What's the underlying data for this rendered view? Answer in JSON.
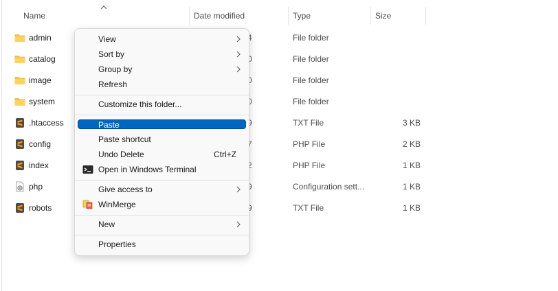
{
  "columns": {
    "name": "Name",
    "date": "Date modified",
    "type": "Type",
    "size": "Size"
  },
  "files": [
    {
      "name": "admin",
      "date": "4",
      "type": "File folder",
      "size": "",
      "icon": "folder-icon"
    },
    {
      "name": "catalog",
      "date": "0",
      "type": "File folder",
      "size": "",
      "icon": "folder-icon"
    },
    {
      "name": "image",
      "date": "0",
      "type": "File folder",
      "size": "",
      "icon": "folder-icon"
    },
    {
      "name": "system",
      "date": "0",
      "type": "File folder",
      "size": "",
      "icon": "folder-icon"
    },
    {
      "name": ".htaccess",
      "date": "9",
      "type": "TXT File",
      "size": "3 KB",
      "icon": "sublime-file-icon"
    },
    {
      "name": "config",
      "date": "7",
      "type": "PHP File",
      "size": "2 KB",
      "icon": "sublime-file-icon"
    },
    {
      "name": "index",
      "date": "2",
      "type": "PHP File",
      "size": "1 KB",
      "icon": "sublime-file-icon"
    },
    {
      "name": "php",
      "date": "9",
      "type": "Configuration sett...",
      "size": "1 KB",
      "icon": "config-file-icon"
    },
    {
      "name": "robots",
      "date": "9",
      "type": "TXT File",
      "size": "1 KB",
      "icon": "sublime-file-icon"
    }
  ],
  "menu": {
    "view": "View",
    "sort_by": "Sort by",
    "group_by": "Group by",
    "refresh": "Refresh",
    "customize": "Customize this folder...",
    "paste": "Paste",
    "paste_shortcut": "Paste shortcut",
    "undo_delete": "Undo Delete",
    "undo_delete_shortcut": "Ctrl+Z",
    "open_terminal": "Open in Windows Terminal",
    "give_access": "Give access to",
    "winmerge": "WinMerge",
    "new": "New",
    "properties": "Properties"
  },
  "colors": {
    "accent": "#0067c0",
    "folder": "#f5c244",
    "sublime": "#ff9800"
  }
}
